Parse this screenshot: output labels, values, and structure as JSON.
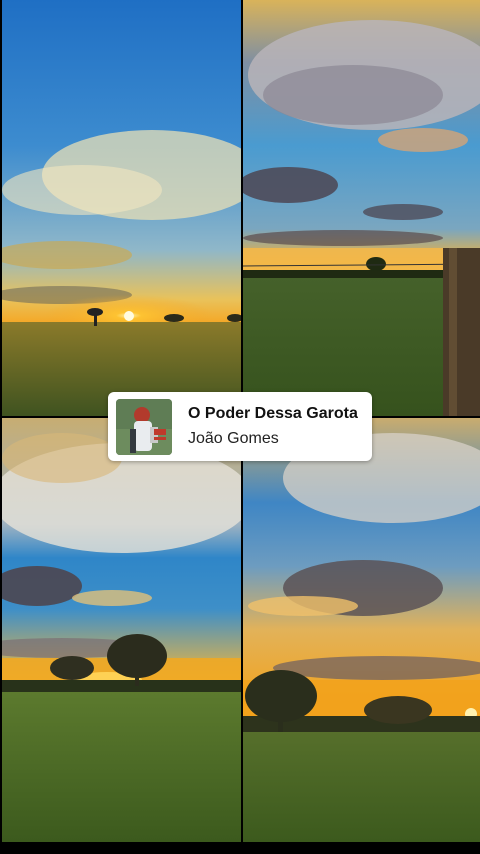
{
  "music_sticker": {
    "song_title": "O Poder Dessa Garota",
    "artist": "João Gomes"
  },
  "icons": {
    "album_cover": "album-cover-art"
  },
  "colors": {
    "card_background": "#ffffff",
    "sky_blue": "#2f7fc8",
    "sunset_orange": "#f2a31a",
    "field_green": "#4f6a2a"
  }
}
